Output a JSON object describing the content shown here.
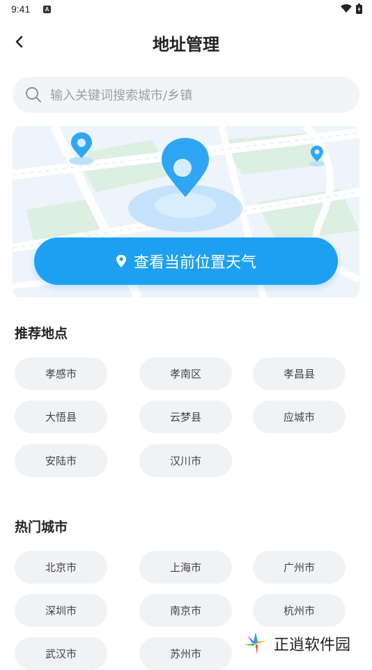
{
  "status_bar": {
    "time": "9:41",
    "notification_glyph": "A"
  },
  "header": {
    "title": "地址管理"
  },
  "search": {
    "placeholder": "输入关键词搜索城市/乡镇",
    "value": ""
  },
  "location_button": {
    "label": "查看当前位置天气"
  },
  "recommended": {
    "title": "推荐地点",
    "items": [
      "孝感市",
      "孝南区",
      "孝昌县",
      "大悟县",
      "云梦县",
      "应城市",
      "安陆市",
      "汉川市"
    ]
  },
  "hot_cities": {
    "title": "热门城市",
    "items": [
      "北京市",
      "上海市",
      "广州市",
      "深圳市",
      "南京市",
      "杭州市",
      "武汉市",
      "苏州市"
    ]
  },
  "watermark": {
    "text": "正逍软件园"
  },
  "colors": {
    "accent": "#1ea0f2",
    "chip_bg": "#f1f2f4",
    "search_bg": "#f3f4f6"
  }
}
